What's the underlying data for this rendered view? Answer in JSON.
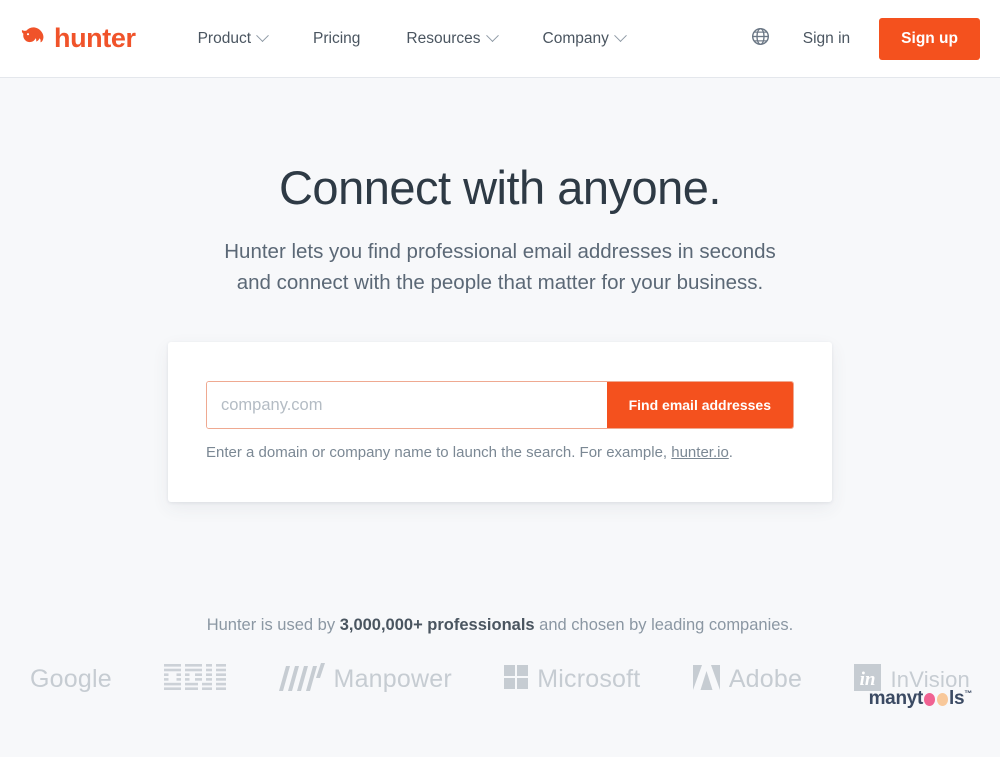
{
  "header": {
    "brand": {
      "name": "hunter",
      "icon": "hunter-hound-icon",
      "color": "#f0532a"
    },
    "nav": [
      {
        "label": "Product",
        "has_dropdown": true
      },
      {
        "label": "Pricing",
        "has_dropdown": false
      },
      {
        "label": "Resources",
        "has_dropdown": true
      },
      {
        "label": "Company",
        "has_dropdown": true
      }
    ],
    "language_icon": "globe-icon",
    "sign_in_label": "Sign in",
    "sign_up_label": "Sign up"
  },
  "hero": {
    "title": "Connect with anyone.",
    "subtitle_line1": "Hunter lets you find professional email addresses in seconds",
    "subtitle_line2": "and connect with the people that matter for your business."
  },
  "search": {
    "placeholder": "company.com",
    "value": "",
    "button_label": "Find email addresses",
    "hint_prefix": "Enter a domain or company name to launch the search. For example, ",
    "hint_link": "hunter.io",
    "hint_suffix": "."
  },
  "social_proof": {
    "text_before": "Hunter is used by ",
    "highlight": "3,000,000+ professionals",
    "text_after": " and chosen by leading companies.",
    "logos": [
      {
        "name": "Google",
        "type": "wordmark"
      },
      {
        "name": "IBM",
        "type": "striped-mark"
      },
      {
        "name": "Manpower",
        "type": "bars-wordmark"
      },
      {
        "name": "Microsoft",
        "type": "squares-wordmark"
      },
      {
        "name": "Adobe",
        "type": "a-mark-wordmark"
      },
      {
        "name": "InVision",
        "type": "wordmark"
      }
    ]
  },
  "watermark": {
    "part1": "manyt",
    "part2": "ls",
    "tm": "™",
    "dot1_color": "#f06292",
    "dot2_color": "#f8c89a"
  },
  "colors": {
    "accent": "#f4511e",
    "brand": "#f0532a",
    "page_bg": "#f7f8fa",
    "heading": "#2e3a45",
    "body_text": "#5b6876",
    "muted": "#8b97a3",
    "logo_gray": "#c6ccd2",
    "input_border": "#efa991"
  }
}
